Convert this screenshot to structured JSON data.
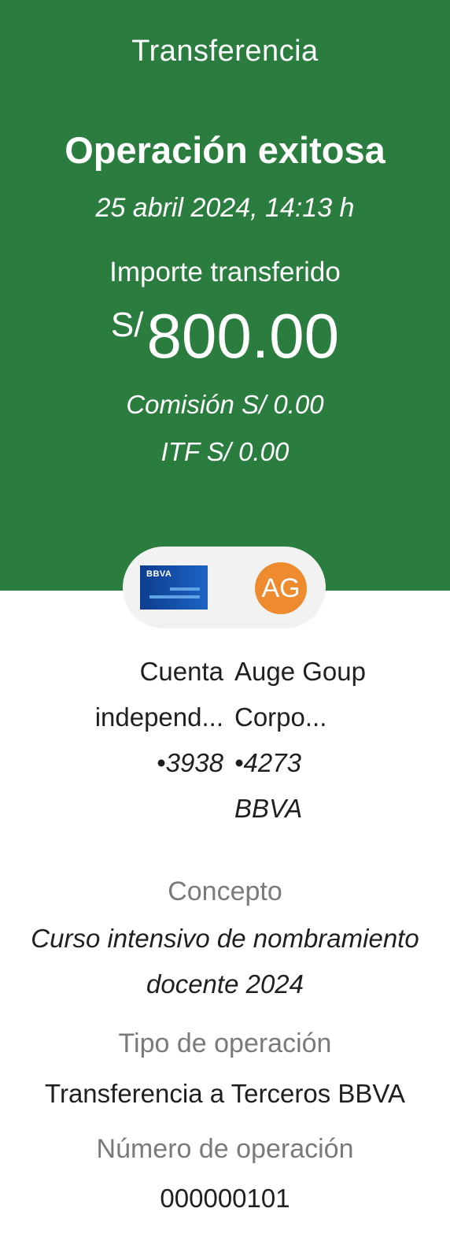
{
  "header": {
    "title": "Transferencia",
    "status": "Operación exitosa",
    "datetime": "25 abril 2024, 14:13 h"
  },
  "amount": {
    "label": "Importe transferido",
    "currency": "S/",
    "value": "800.00",
    "fee": "Comisión  S/ 0.00",
    "itf": "ITF  S/ 0.00"
  },
  "accounts": {
    "origin": {
      "bank_logo_text": "BBVA",
      "name_line1": "Cuenta",
      "name_line2": "independ...",
      "number": "•3938"
    },
    "destination": {
      "avatar_initials": "AG",
      "name_line1": "Auge Goup",
      "name_line2": "Corpo...",
      "number": "•4273",
      "bank": "BBVA"
    }
  },
  "details": {
    "concept_label": "Concepto",
    "concept_value": "Curso intensivo de nombramiento docente 2024",
    "type_label": "Tipo de operación",
    "type_value": "Transferencia a Terceros BBVA",
    "opnum_label": "Número de operación",
    "opnum_value": "000000101"
  },
  "colors": {
    "header_bg": "#2a7d3f",
    "avatar_bg": "#ee8b2e",
    "bank_card": "#1d63c3"
  }
}
